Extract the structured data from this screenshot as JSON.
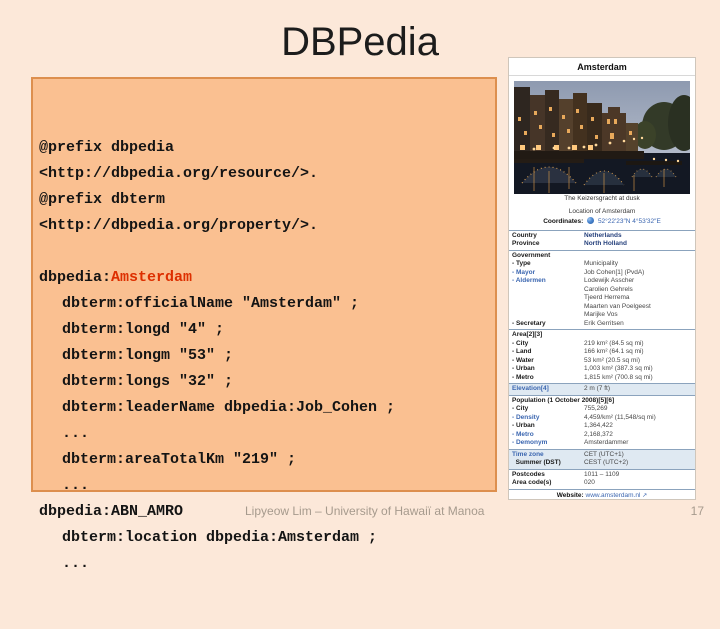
{
  "slide": {
    "title": "DBPedia",
    "footer": "Lipyeow Lim – University of Hawaiï at Manoa",
    "page_number": "17"
  },
  "colors": {
    "slide_bg": "#fce8d9",
    "code_box_bg": "#fac091",
    "code_box_border": "#dd8f4e",
    "highlight_red": "#dd2f00",
    "link_blue": "#3b66b0",
    "navy_link": "#26417c"
  },
  "code_block": {
    "lines": [
      {
        "segments": [
          {
            "text": "@prefix dbpedia"
          }
        ]
      },
      {
        "segments": [
          {
            "text": "<http://dbpedia.org/resource/>."
          }
        ]
      },
      {
        "segments": [
          {
            "text": "@prefix dbterm"
          }
        ]
      },
      {
        "segments": [
          {
            "text": "<http://dbpedia.org/property/>."
          }
        ]
      },
      {
        "blank": true
      },
      {
        "segments": [
          {
            "text": "dbpedia:"
          },
          {
            "text": "Amsterdam",
            "class": "red"
          }
        ]
      },
      {
        "indent": 1,
        "segments": [
          {
            "text": "dbterm:officialName \"Amsterdam\" ;"
          }
        ]
      },
      {
        "indent": 1,
        "segments": [
          {
            "text": "dbterm:longd \"4″ ;"
          }
        ]
      },
      {
        "indent": 1,
        "segments": [
          {
            "text": "dbterm:longm \"53\" ;"
          }
        ]
      },
      {
        "indent": 1,
        "segments": [
          {
            "text": "dbterm:longs \"32″ ;"
          }
        ]
      },
      {
        "indent": 1,
        "segments": [
          {
            "text": "dbterm:leaderName dbpedia:Job_Cohen ;"
          }
        ]
      },
      {
        "indent": 1,
        "segments": [
          {
            "text": "..."
          }
        ]
      },
      {
        "indent": 1,
        "segments": [
          {
            "text": "dbterm:areaTotalKm \"219\" ;"
          }
        ]
      },
      {
        "indent": 1,
        "segments": [
          {
            "text": "..."
          }
        ]
      },
      {
        "segments": [
          {
            "text": "dbpedia:ABN_AMRO"
          }
        ]
      },
      {
        "indent": 1,
        "segments": [
          {
            "text": "dbterm:location dbpedia:Amsterdam ;"
          }
        ]
      },
      {
        "indent": 1,
        "segments": [
          {
            "text": "..."
          }
        ]
      }
    ]
  },
  "infobox": {
    "title": "Amsterdam",
    "photo_caption": "The Keizersgracht at dusk",
    "location_caption": "Location of Amsterdam",
    "coordinates_label": "Coordinates:",
    "coordinates_value": "52°22′23″N 4°53′32″E",
    "icons": {
      "globe_icon": "blue globe sphere",
      "external_link_icon": "↗"
    },
    "website_label": "Website:",
    "website_value": "www.amsterdam.nl",
    "sections": [
      {
        "rows": [
          {
            "label": "Country",
            "value": "Netherlands",
            "value_class": "navy"
          },
          {
            "label": "Province",
            "value": "North Holland",
            "value_class": "navy"
          }
        ]
      },
      {
        "rows": [
          {
            "label": "Government",
            "span": true
          },
          {
            "label": "- Type",
            "value": "Municipality"
          },
          {
            "label": "- Mayor",
            "value": "Job Cohen[1] (PvdA)",
            "label_class": "link"
          },
          {
            "label": "- Aldermen",
            "values": [
              "Lodewijk Asscher",
              "Carolien Gehrels",
              "Tjeerd Herrema",
              "Maarten van Poelgeest",
              "Marijke Vos"
            ],
            "label_class": "link"
          },
          {
            "label": "- Secretary",
            "value": "Erik Gerritsen"
          }
        ]
      },
      {
        "rows": [
          {
            "label": "Area[2][3]",
            "span": true
          },
          {
            "label": "- City",
            "value": "219 km² (84.5 sq mi)"
          },
          {
            "label": "- Land",
            "value": "166 km² (64.1 sq mi)"
          },
          {
            "label": "- Water",
            "value": "53 km² (20.5 sq mi)"
          },
          {
            "label": "- Urban",
            "value": "1,003 km² (387.3 sq mi)"
          },
          {
            "label": "- Metro",
            "value": "1,815 km² (700.8 sq mi)"
          }
        ]
      },
      {
        "band": true,
        "rows": [
          {
            "label": "Elevation[4]",
            "value": "2 m (7 ft)",
            "label_class": "link"
          }
        ]
      },
      {
        "rows": [
          {
            "label": "Population (1 October 2008)[5][6]",
            "span": true
          },
          {
            "label": "- City",
            "value": "755,269"
          },
          {
            "label": "- Density",
            "value": "4,459/km² (11,548/sq mi)",
            "label_class": "link"
          },
          {
            "label": "- Urban",
            "value": "1,364,422"
          },
          {
            "label": "- Metro",
            "value": "2,168,372",
            "label_class": "link"
          },
          {
            "label": "- Demonym",
            "value": "Amsterdammer",
            "label_class": "link"
          }
        ]
      },
      {
        "band": true,
        "rows": [
          {
            "label": "Time zone",
            "value": "CET (UTC+1)",
            "label_class": "link"
          },
          {
            "label": "  Summer (DST)",
            "value": "CEST (UTC+2)"
          }
        ]
      },
      {
        "rows": [
          {
            "label": "Postcodes",
            "value": "1011 – 1109"
          },
          {
            "label": "Area code(s)",
            "value": "020"
          }
        ]
      },
      {
        "rows": [
          {
            "website": true
          }
        ]
      }
    ]
  }
}
